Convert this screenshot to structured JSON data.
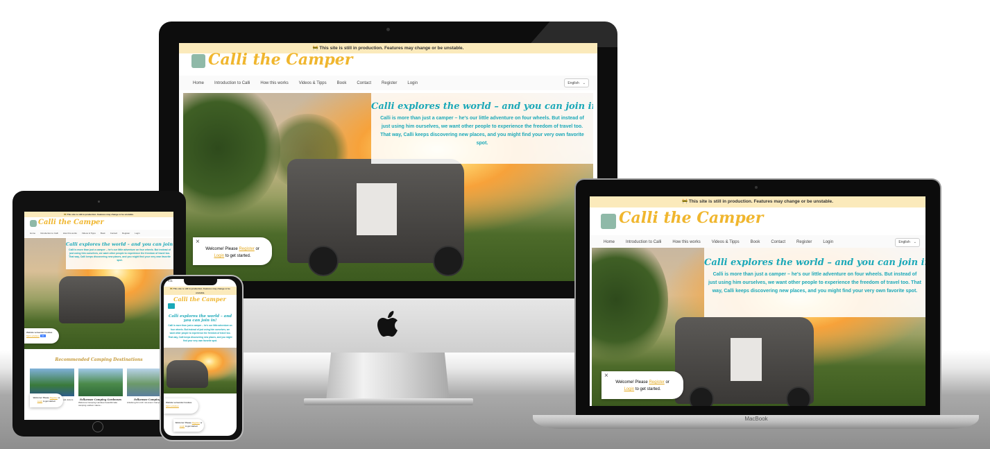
{
  "site": {
    "banner": "🚧 This site is still in production. Features may change or be unstable.",
    "logo_text": "Calli the Camper",
    "logo_badge": "Calli the Camper",
    "nav": [
      "Home",
      "Introduction to Calli",
      "How this works",
      "Videos & Tipps",
      "Book",
      "Contact",
      "Register",
      "Login"
    ],
    "language": "English",
    "hero_title": "Calli explores the world – and you can join in!",
    "hero_text": "Calli is more than just a camper – he's our little adventure on four wheels. But instead of just using him ourselves, we want other people to experience the freedom of travel too. That way, Calli keeps discovering new places, and you might find your very own favorite spot.",
    "popup": {
      "close": "×",
      "line1": "Welcome! Please",
      "register": "Register",
      "or": "or",
      "login": "Login",
      "line2": "to get started."
    },
    "cookie": {
      "text": "Website verwendet Cookies.",
      "more": "Mehr erfahren",
      "ok": "OK"
    },
    "recommended_title": "Recommended Camping Destinations",
    "destinations": [
      {
        "name": "Lake Camping",
        "text": "\"Our Lodge Camping Bled brilliant\" and visitors on Instagram and fish..."
      },
      {
        "name": "Falkensee Camping Gardenses",
        "text": "Welcome Camping Landsee beautiful lake camping outdoor nature..."
      },
      {
        "name": "Falkensee Camping Ki",
        "text": "Anleitung für mich mit einem Campingplatz..."
      }
    ],
    "phone_time": "9:41"
  },
  "devices": {
    "macbook_label": "MacBook",
    "apple_logo": "apple-icon"
  },
  "colors": {
    "banner": "#fbeabb",
    "logo": "#f0b62e",
    "hero_text": "#1aa8b8",
    "link": "#e3a81e"
  }
}
